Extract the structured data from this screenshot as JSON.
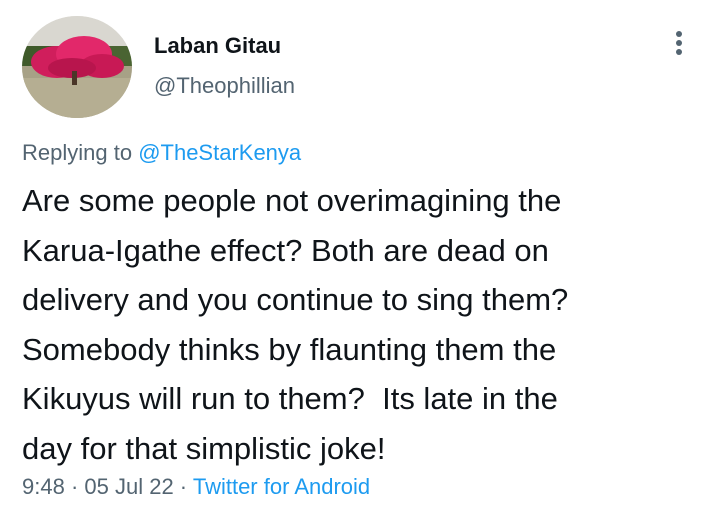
{
  "author": {
    "display_name": "Laban Gitau",
    "handle": "@Theophillian",
    "avatar_icon": "avatar-photo-red-tree"
  },
  "menu": {
    "icon": "more-vertical-icon"
  },
  "reply": {
    "prefix": "Replying to ",
    "mention": "@TheStarKenya"
  },
  "tweet": {
    "lines": [
      "Are some people not overimagining the",
      "Karua-Igathe effect? Both are dead on",
      "delivery and you continue to sing them?",
      "Somebody thinks by flaunting them the",
      "Kikuyus will run to them?  Its late in the",
      "day for that simplistic joke!"
    ]
  },
  "meta": {
    "time": "9:48",
    "separator": " · ",
    "date": "05 Jul 22",
    "source": "Twitter for Android"
  },
  "colors": {
    "text": "#0f1419",
    "secondary": "#536471",
    "link": "#1d9bf0"
  }
}
